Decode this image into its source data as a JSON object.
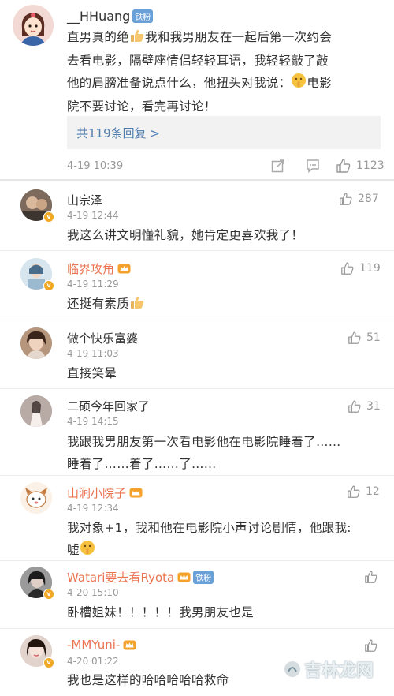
{
  "colors": {
    "accent_blue": "#507daf",
    "vip_orange": "#eb7350",
    "muted": "#999999"
  },
  "main_post": {
    "username": "__HHuang",
    "badge": "铁粉",
    "text_line1": "直男真的绝",
    "text_line1b": "我和我男朋友在一起后第一次约会",
    "text_line2": "去看电影，隔壁座情侣轻轻耳语，我轻轻敲了敲",
    "text_line3": "他的肩膀准备说点什么，他扭头对我说：",
    "text_line3b": "电影",
    "text_line4": "院不要讨论，看完再讨论！",
    "replies_link": "共119条回复 >",
    "time": "4-19 10:39",
    "likes": "1123"
  },
  "comments": [
    {
      "name": "山宗泽",
      "vip": false,
      "time": "4-19 12:44",
      "likes": "287",
      "lines": [
        "我这么讲文明懂礼貌，她肯定更喜欢我了！"
      ]
    },
    {
      "name": "临界攻角",
      "vip": true,
      "time": "4-19 11:29",
      "likes": "119",
      "lines": [
        "还挺有素质"
      ]
    },
    {
      "name": "做个快乐富婆",
      "vip": false,
      "time": "4-19 11:03",
      "likes": "51",
      "lines": [
        "直接笑晕"
      ]
    },
    {
      "name": "二硕今年回家了",
      "vip": false,
      "time": "4-19 14:15",
      "likes": "31",
      "lines": [
        "我跟我男朋友第一次看电影他在电影院睡着了……",
        "睡着了……着了……了……"
      ]
    },
    {
      "name": "山涧小院子",
      "vip": true,
      "time": "4-19 12:34",
      "likes": "12",
      "lines": [
        "我对象+1，我和他在电影院小声讨论剧情，他跟我:",
        "嘘"
      ]
    },
    {
      "name": "Watari要去看Ryota",
      "vip": true,
      "badge": "铁粉",
      "time": "4-20 15:10",
      "likes": "",
      "lines": [
        "卧槽姐妹！！！！！我男朋友也是"
      ]
    },
    {
      "name": "-MMYuni-",
      "vip": true,
      "time": "4-20 01:22",
      "likes": "",
      "lines": [
        "我也是这样的哈哈哈哈哈救命"
      ]
    }
  ],
  "watermark": "吉林龙网"
}
